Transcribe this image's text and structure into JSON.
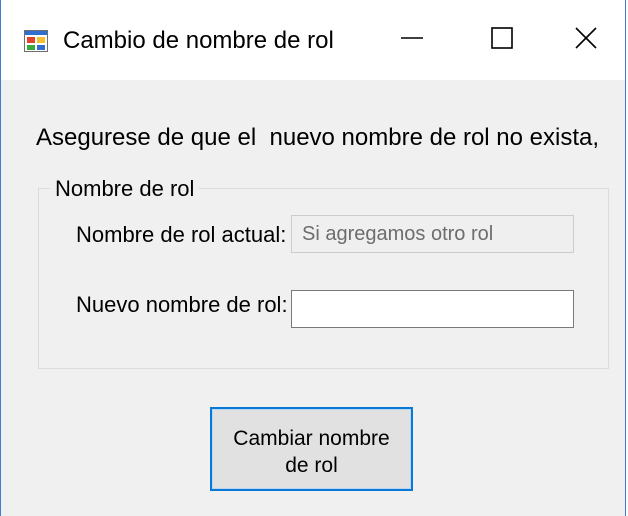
{
  "window": {
    "title": "Cambio de nombre de rol",
    "icon": "form-icon",
    "controls": {
      "minimize_icon": "minimize-icon",
      "maximize_icon": "maximize-icon",
      "close_icon": "close-icon"
    }
  },
  "form": {
    "message": "Asegurese de que el  nuevo nombre de rol no exista,",
    "group_title": "Nombre de rol",
    "current_label": "Nombre de rol actual:",
    "current_value": "Si agregamos otro rol",
    "new_label": "Nuevo nombre de rol:",
    "new_value": "",
    "button_line1": "Cambiar nombre",
    "button_line2": "de rol"
  },
  "colors": {
    "accent": "#0a78d7",
    "window_border": "#3c7fd0",
    "background": "#f0f0f0"
  }
}
